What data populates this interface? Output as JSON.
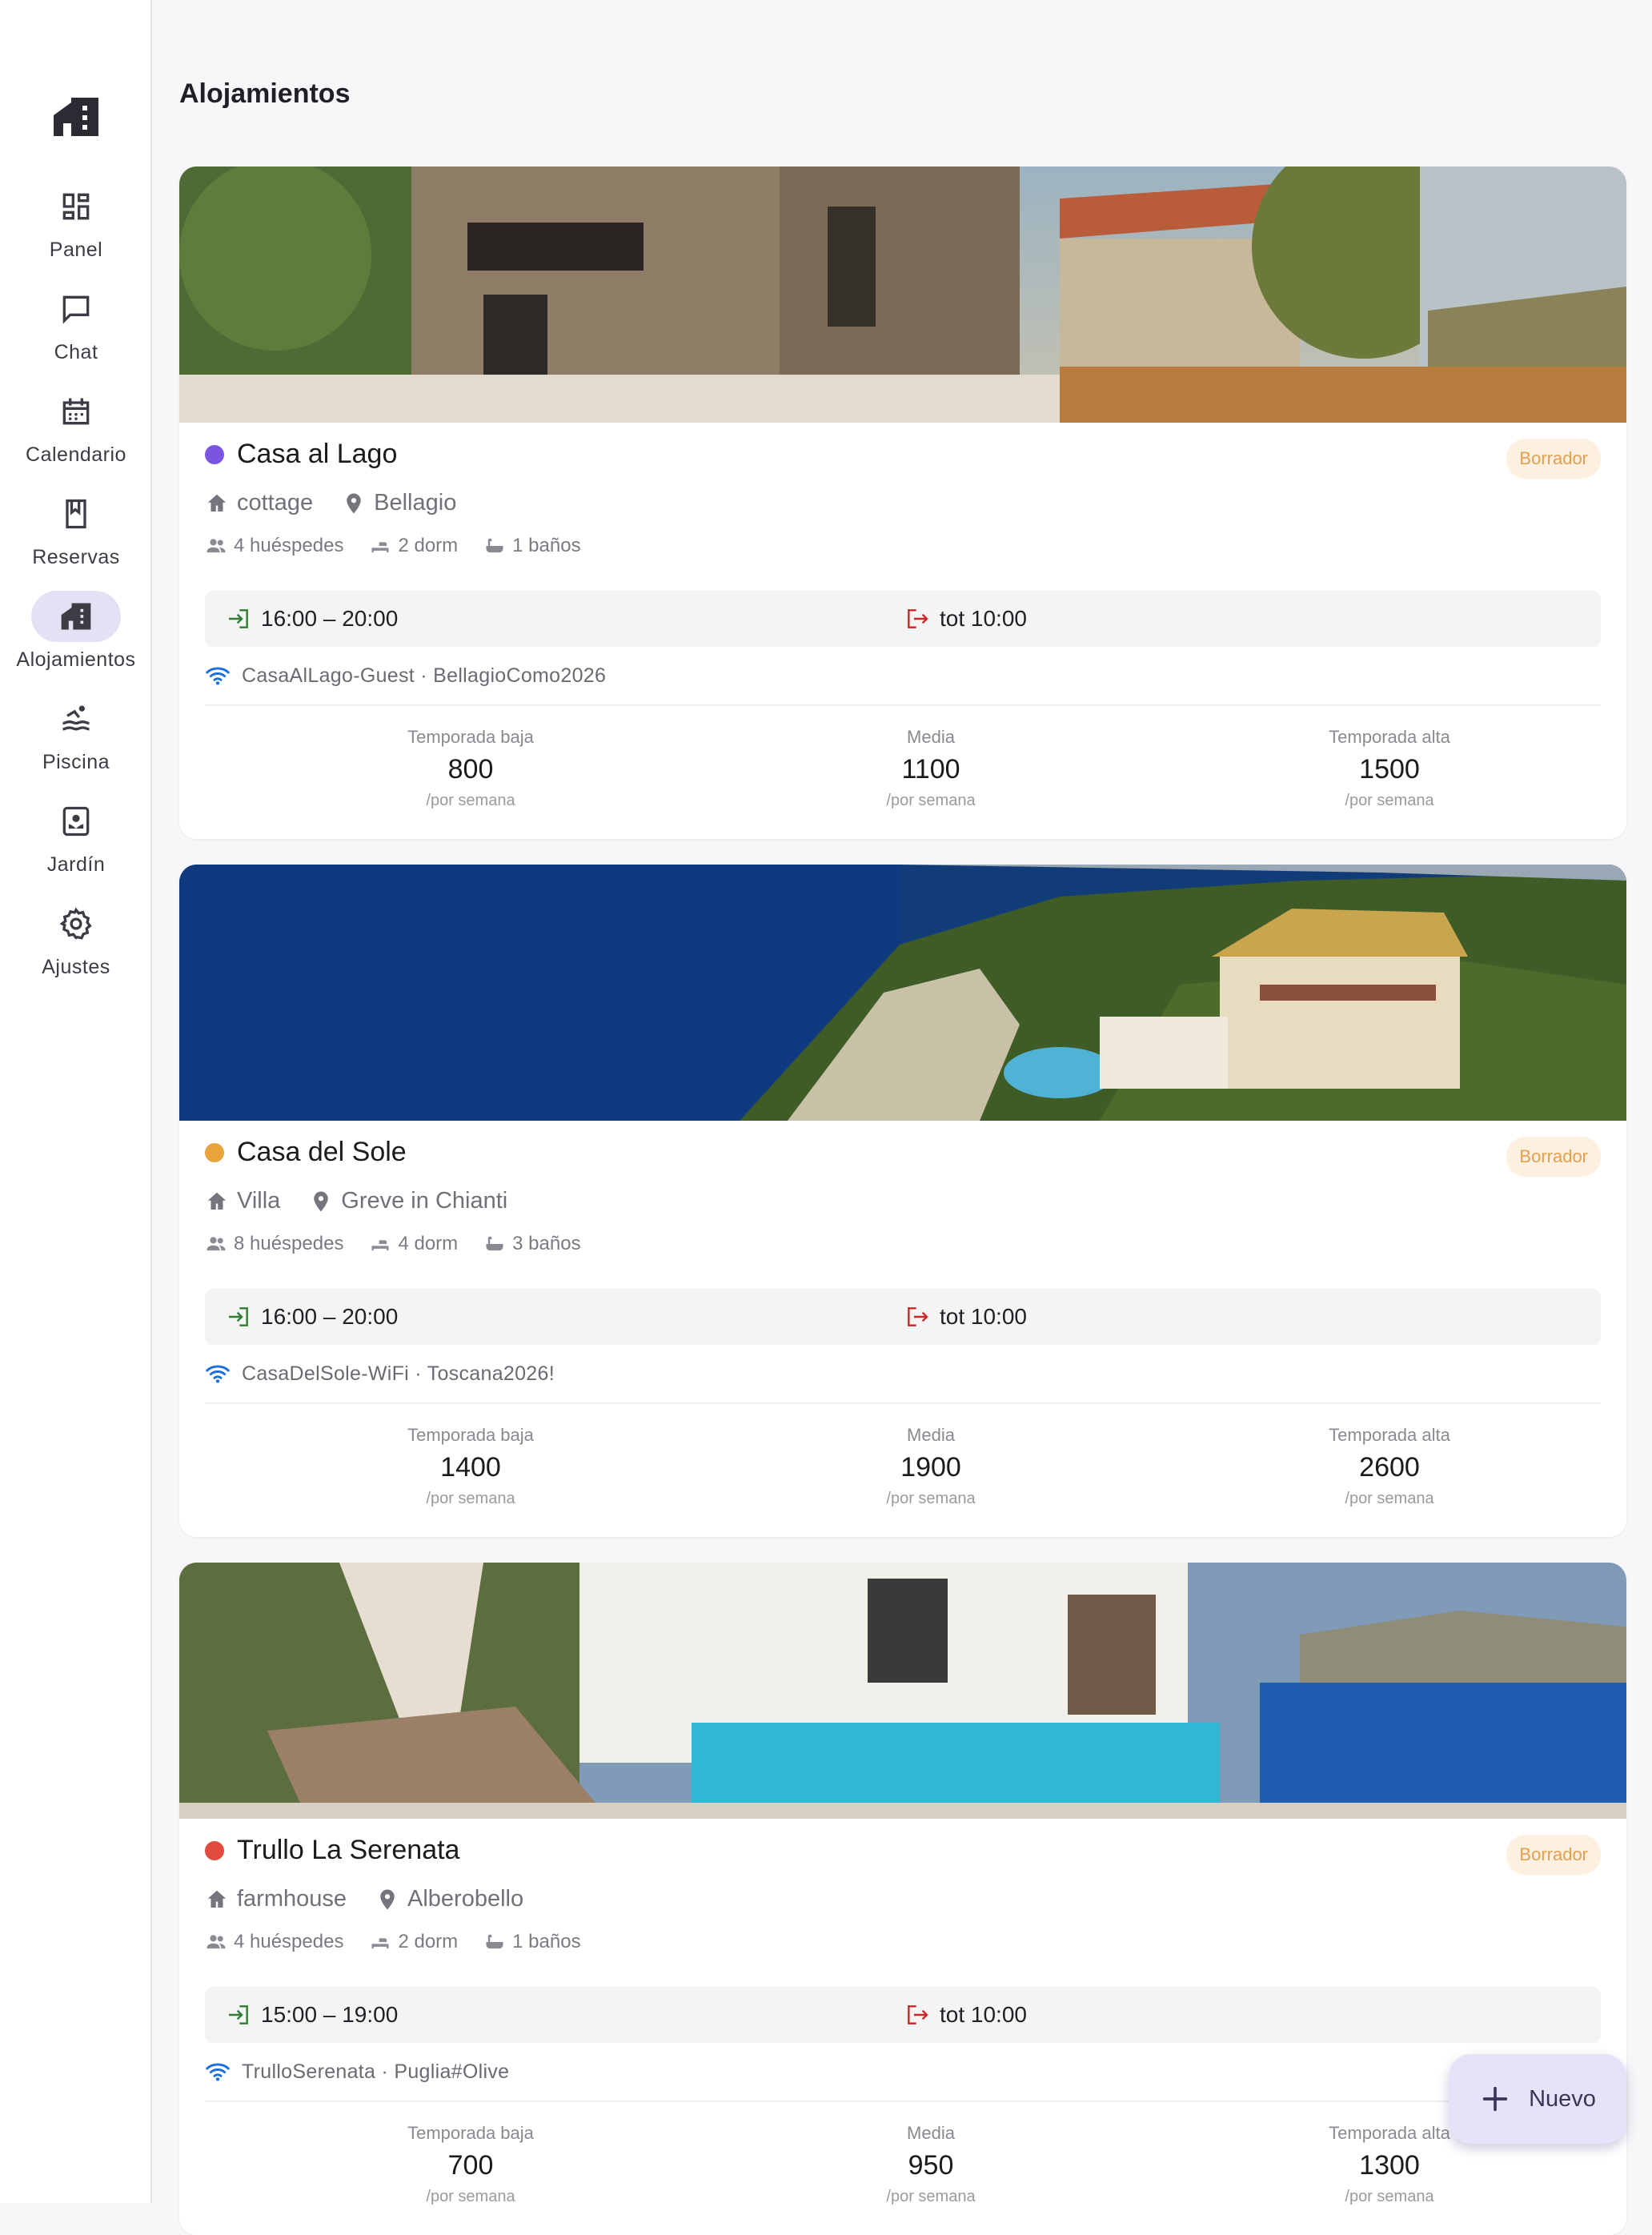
{
  "app": {
    "page_title": "Alojamientos"
  },
  "sidebar": {
    "items": [
      {
        "label": "Panel",
        "icon": "dashboard-icon",
        "active": false
      },
      {
        "label": "Chat",
        "icon": "chat-icon",
        "active": false
      },
      {
        "label": "Calendario",
        "icon": "calendar-icon",
        "active": false
      },
      {
        "label": "Reservas",
        "icon": "bookmark-icon",
        "active": false
      },
      {
        "label": "Alojamientos",
        "icon": "house-icon",
        "active": true
      },
      {
        "label": "Piscina",
        "icon": "pool-icon",
        "active": false
      },
      {
        "label": "Jardín",
        "icon": "garden-icon",
        "active": false
      },
      {
        "label": "Ajustes",
        "icon": "gear-icon",
        "active": false
      }
    ]
  },
  "colors": {
    "accent": "#e4e1f5",
    "badge_bg": "#fdf0e0",
    "badge_text": "#e3a04a",
    "checkin_icon": "#2e7d32",
    "checkout_icon": "#c62828",
    "wifi_icon": "#1e6fd9"
  },
  "properties": [
    {
      "name": "Casa al Lago",
      "color": "#7b55e0",
      "status": "Borrador",
      "type": "cottage",
      "location": "Bellagio",
      "guests": "4 huéspedes",
      "bedrooms": "2 dorm",
      "bathrooms": "1 baños",
      "checkin": "16:00 – 20:00",
      "checkout": "tot 10:00",
      "wifi": "CasaAlLago-Guest · BellagioComo2026",
      "prices": [
        {
          "label": "Temporada baja",
          "value": "800",
          "unit": "/por semana"
        },
        {
          "label": "Media",
          "value": "1100",
          "unit": "/por semana"
        },
        {
          "label": "Temporada alta",
          "value": "1500",
          "unit": "/por semana"
        }
      ]
    },
    {
      "name": "Casa del Sole",
      "color": "#e8a33a",
      "status": "Borrador",
      "type": "Villa",
      "location": "Greve in Chianti",
      "guests": "8 huéspedes",
      "bedrooms": "4 dorm",
      "bathrooms": "3 baños",
      "checkin": "16:00 – 20:00",
      "checkout": "tot 10:00",
      "wifi": "CasaDelSole-WiFi · Toscana2026!",
      "prices": [
        {
          "label": "Temporada baja",
          "value": "1400",
          "unit": "/por semana"
        },
        {
          "label": "Media",
          "value": "1900",
          "unit": "/por semana"
        },
        {
          "label": "Temporada alta",
          "value": "2600",
          "unit": "/por semana"
        }
      ]
    },
    {
      "name": "Trullo La Serenata",
      "color": "#e04b3e",
      "status": "Borrador",
      "type": "farmhouse",
      "location": "Alberobello",
      "guests": "4 huéspedes",
      "bedrooms": "2 dorm",
      "bathrooms": "1 baños",
      "checkin": "15:00 – 19:00",
      "checkout": "tot 10:00",
      "wifi": "TrulloSerenata · Puglia#Olive",
      "prices": [
        {
          "label": "Temporada baja",
          "value": "700",
          "unit": "/por semana"
        },
        {
          "label": "Media",
          "value": "950",
          "unit": "/por semana"
        },
        {
          "label": "Temporada alta",
          "value": "1300",
          "unit": "/por semana"
        }
      ]
    }
  ],
  "fab": {
    "label": "Nuevo",
    "icon": "plus-icon"
  }
}
